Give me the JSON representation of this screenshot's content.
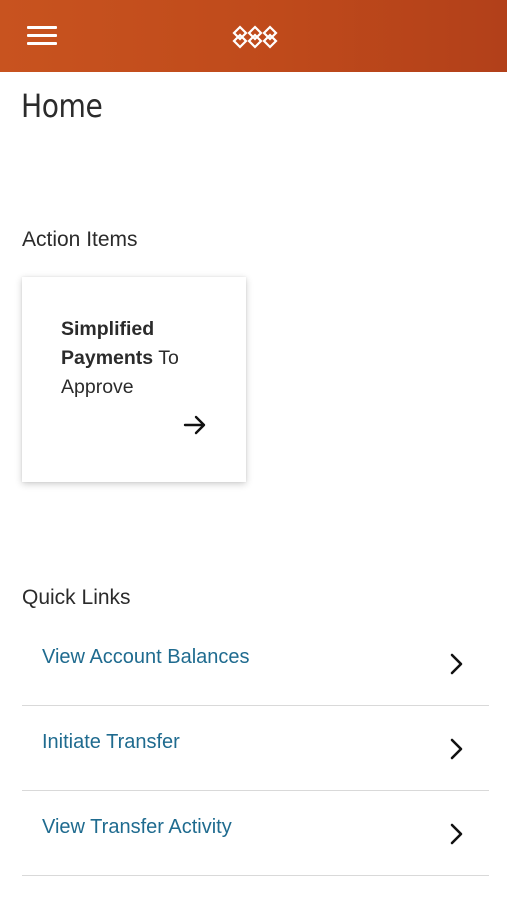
{
  "header": {
    "menu_icon": "hamburger-menu-icon",
    "logo_icon": "interlocking-rings-logo",
    "colors": {
      "bar_start": "#c8531f",
      "bar_end": "#b2401a"
    }
  },
  "page": {
    "title": "Home"
  },
  "action_items": {
    "heading": "Action Items",
    "cards": [
      {
        "title_bold": "Simplified Payments",
        "title_rest": " To Approve",
        "icon": "arrow-right-icon"
      }
    ]
  },
  "quick_links": {
    "heading": "Quick Links",
    "link_color": "#1f6b8f",
    "items": [
      {
        "label": "View Account Balances",
        "icon": "chevron-right-icon"
      },
      {
        "label": "Initiate Transfer",
        "icon": "chevron-right-icon"
      },
      {
        "label": "View Transfer Activity",
        "icon": "chevron-right-icon"
      }
    ]
  }
}
